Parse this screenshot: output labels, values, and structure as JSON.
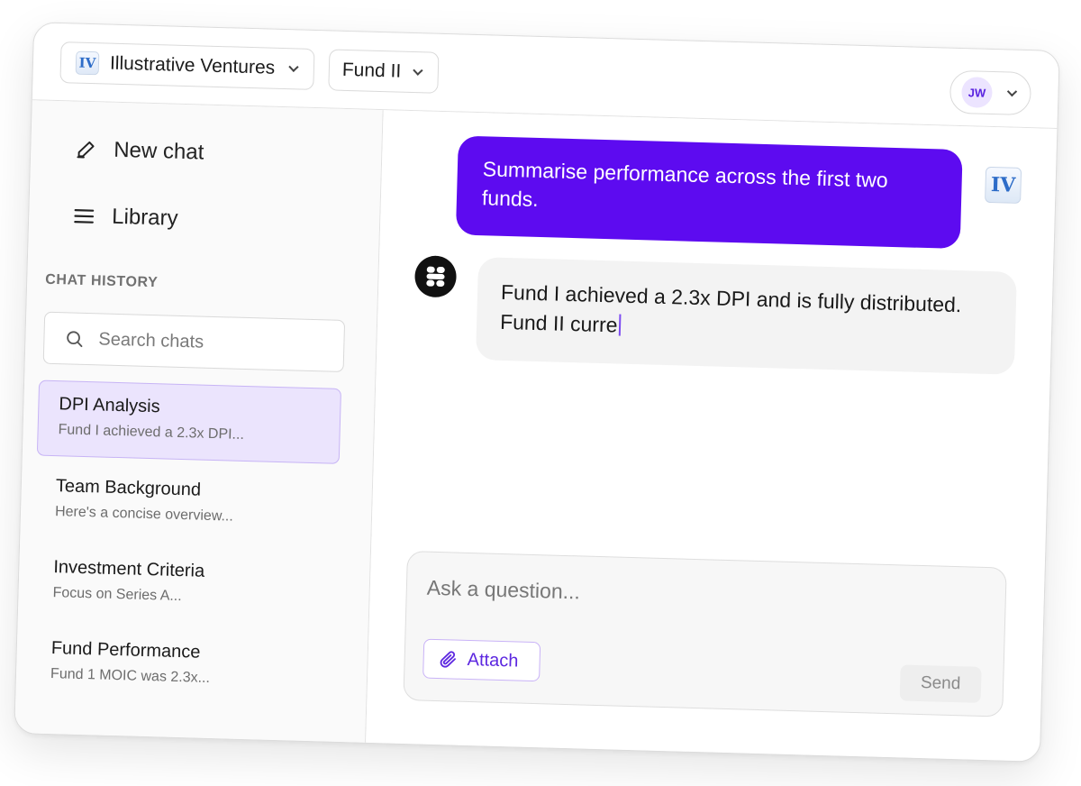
{
  "header": {
    "org_logo_text": "IV",
    "org_name": "Illustrative Ventures",
    "fund_name": "Fund II",
    "user_initials": "JW"
  },
  "sidebar": {
    "new_chat_label": "New chat",
    "library_label": "Library",
    "history_heading": "CHAT HISTORY",
    "search_placeholder": "Search chats",
    "items": [
      {
        "title": "DPI Analysis",
        "preview": "Fund I achieved a 2.3x DPI...",
        "active": true
      },
      {
        "title": "Team Background",
        "preview": "Here's a concise overview...",
        "active": false
      },
      {
        "title": "Investment Criteria",
        "preview": "Focus on Series A...",
        "active": false
      },
      {
        "title": "Fund Performance",
        "preview": "Fund 1 MOIC was 2.3x...",
        "active": false
      }
    ]
  },
  "conversation": {
    "user_message": "Summarise performance across the first two funds.",
    "user_avatar_text": "IV",
    "assistant_message": "Fund I achieved a 2.3x DPI and is fully distributed. Fund II curre"
  },
  "composer": {
    "placeholder": "Ask a question...",
    "attach_label": "Attach",
    "send_label": "Send"
  },
  "colors": {
    "accent": "#5d0bf0",
    "active_item_bg": "#ebe4fd",
    "logo_blue": "#2d6cc8"
  }
}
